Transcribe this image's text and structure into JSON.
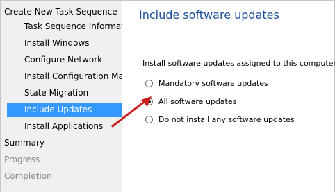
{
  "nav": {
    "items": [
      {
        "label": "Create New Task Sequence"
      },
      {
        "label": "Task Sequence Information"
      },
      {
        "label": "Install Windows"
      },
      {
        "label": "Configure Network"
      },
      {
        "label": "Install Configuration Manager"
      },
      {
        "label": "State Migration"
      },
      {
        "label": "Include Updates",
        "selected": true
      },
      {
        "label": "Install Applications"
      },
      {
        "label": "Summary"
      },
      {
        "label": "Progress",
        "disabled": true
      },
      {
        "label": "Completion",
        "disabled": true
      }
    ]
  },
  "page": {
    "title": "Include software updates",
    "instruction": "Install software updates assigned to this computer."
  },
  "options": [
    {
      "label": "Mandatory software updates",
      "checked": false
    },
    {
      "label": "All software updates",
      "checked": true
    },
    {
      "label": "Do not install any software updates",
      "checked": false
    }
  ],
  "colors": {
    "nav_background": "#f0f0f0",
    "selection": "#3399ff",
    "heading": "#1a4f9c",
    "arrow": "#cc1f1f"
  }
}
